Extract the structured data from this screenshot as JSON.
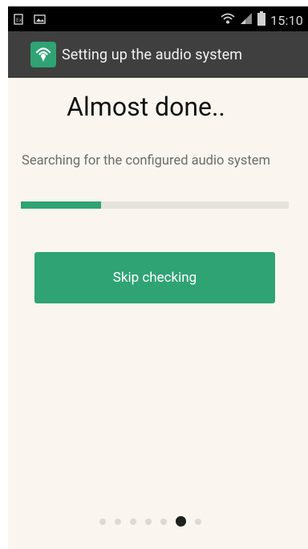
{
  "status_bar": {
    "time": "15:10",
    "left_icons": [
      "sim-card-icon",
      "image-notification-icon"
    ],
    "right_icons": [
      "wifi-icon",
      "signal-icon",
      "battery-icon"
    ]
  },
  "action_bar": {
    "app_icon": "audio-system-app-icon",
    "title": "Setting up the audio system"
  },
  "main": {
    "headline": "Almost done..",
    "status_text": "Searching for the configured audio system",
    "progress_fraction": 0.3,
    "skip_button_label": "Skip checking"
  },
  "pager": {
    "count": 7,
    "active_index": 5
  },
  "colors": {
    "accent": "#2fa374",
    "background": "#faf6ef",
    "action_bar": "#3f3f3f",
    "status_bar": "#000000"
  }
}
